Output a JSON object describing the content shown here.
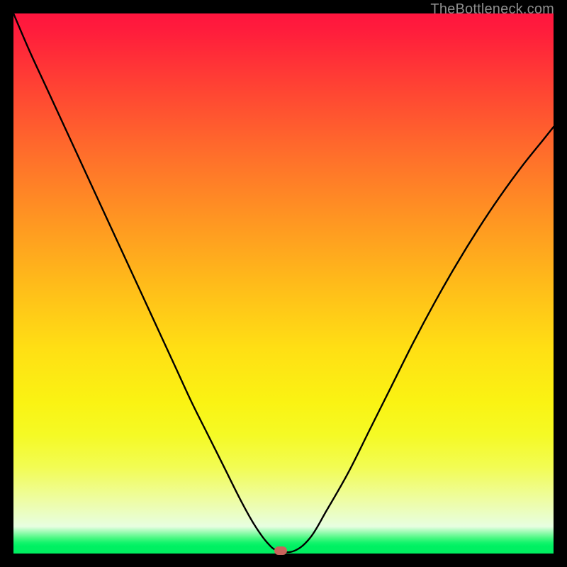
{
  "watermark": "TheBottleneck.com",
  "colors": {
    "frame": "#000000",
    "marker": "#c8645c",
    "curve": "#000000"
  },
  "chart_data": {
    "type": "line",
    "title": "",
    "xlabel": "",
    "ylabel": "",
    "xlim": [
      0,
      100
    ],
    "ylim": [
      0,
      100
    ],
    "grid": false,
    "x": [
      0,
      3,
      6,
      9,
      12,
      15,
      18,
      21,
      24,
      27,
      30,
      33,
      36,
      39,
      42,
      44.5,
      47,
      49,
      52,
      55,
      58,
      62,
      66,
      70,
      74,
      78,
      82,
      86,
      90,
      94,
      98,
      100
    ],
    "y": [
      100,
      93,
      86.5,
      80,
      73.5,
      67,
      60.5,
      54,
      47.5,
      41,
      34.5,
      28,
      22,
      16,
      10,
      5.5,
      2,
      0.5,
      0.5,
      3,
      8,
      15,
      23,
      31,
      39,
      46.5,
      53.5,
      60,
      66,
      71.5,
      76.5,
      79
    ],
    "marker": {
      "x": 49.5,
      "y": 0.5
    },
    "background_gradient": {
      "direction": "vertical",
      "stops": [
        {
          "pos": 0.0,
          "color": "#ff153e"
        },
        {
          "pos": 0.5,
          "color": "#ffbb1a"
        },
        {
          "pos": 0.78,
          "color": "#f5fa25"
        },
        {
          "pos": 0.95,
          "color": "#e7fee1"
        },
        {
          "pos": 0.98,
          "color": "#12f46c"
        },
        {
          "pos": 1.0,
          "color": "#00ee60"
        }
      ]
    }
  }
}
